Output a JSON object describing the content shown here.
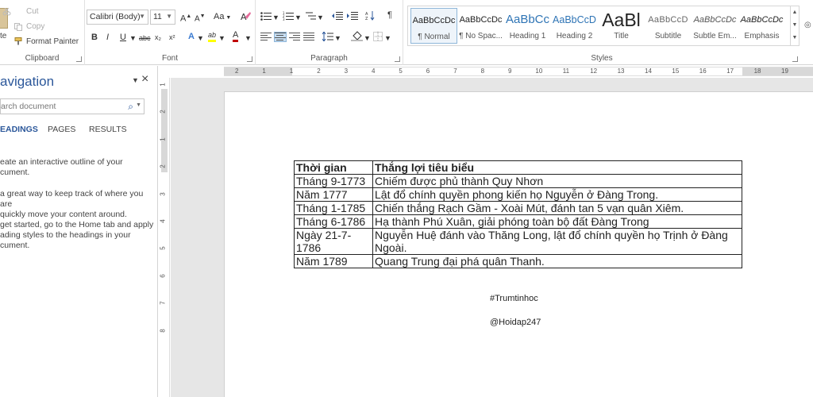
{
  "clipboard": {
    "cut_label": "Cut",
    "copy_label": "Copy",
    "format_painter_label": "Format Painter",
    "paste_fragment": "te",
    "group_label": "Clipboard"
  },
  "font": {
    "family": "Calibri (Body)",
    "size": "11",
    "grow": "A",
    "shrink": "A",
    "change_case": "Aa",
    "bold": "B",
    "italic": "I",
    "underline": "U",
    "strikethrough": "abc",
    "subscript": "x₂",
    "superscript": "x²",
    "text_effects": "A",
    "highlight": "ab",
    "font_color": "A",
    "group_label": "Font"
  },
  "paragraph": {
    "show_marks": "¶",
    "group_label": "Paragraph"
  },
  "styles": {
    "group_label": "Styles",
    "items": [
      {
        "sample": "AaBbCcDc",
        "name": "¶ Normal"
      },
      {
        "sample": "AaBbCcDc",
        "name": "¶ No Spac..."
      },
      {
        "sample": "AaBbCc",
        "name": "Heading 1"
      },
      {
        "sample": "AaBbCcD",
        "name": "Heading 2"
      },
      {
        "sample": "AaBl",
        "name": "Title"
      },
      {
        "sample": "AaBbCcD",
        "name": "Subtitle"
      },
      {
        "sample": "AaBbCcDc",
        "name": "Subtle Em..."
      },
      {
        "sample": "AaBbCcDc",
        "name": "Emphasis"
      }
    ]
  },
  "nav": {
    "title": "avigation",
    "search_placeholder": "arch document",
    "tabs": [
      "EADINGS",
      "PAGES",
      "RESULTS"
    ],
    "paragraphs": [
      "eate an interactive outline of your\ncument.",
      "a great way to keep track of where you are\nquickly move your content around.",
      "get started, go to the Home tab and apply\nading styles to the headings in your\ncument."
    ]
  },
  "ruler": {
    "h_ticks": [
      "2",
      "1",
      "1",
      "2",
      "3",
      "4",
      "5",
      "6",
      "7",
      "8",
      "9",
      "10",
      "11",
      "12",
      "13",
      "14",
      "15",
      "16",
      "17",
      "18",
      "19"
    ],
    "v_ticks": [
      "1",
      "2",
      "1",
      "2",
      "3",
      "4",
      "5",
      "6",
      "7",
      "8"
    ]
  },
  "document": {
    "table": {
      "headers": [
        "Thời gian",
        "Thắng lợi tiêu biểu"
      ],
      "rows": [
        [
          "Tháng 9-1773",
          "Chiếm được phủ thành Quy Nhơn"
        ],
        [
          "Năm 1777",
          "Lật đổ chính quyền phong kiến họ Nguyễn ở Đàng Trong."
        ],
        [
          "Tháng 1-1785",
          "Chiến thắng Rạch Gầm - Xoài Mút, đánh tan 5 vạn quân Xiêm."
        ],
        [
          "Tháng 6-1786",
          "Hạ thành Phú Xuân, giải phóng toàn bộ đất Đàng Trong"
        ],
        [
          "Ngày 21-7-1786",
          "Nguyễn Huệ đánh vào Thăng Long, lật đổ chính quyền họ Trịnh ở Đàng Ngoài."
        ],
        [
          "Năm 1789",
          "Quang Trung đại phá quân Thanh."
        ]
      ]
    },
    "tag1": "#Trumtinhoc",
    "tag2": "@Hoidap247"
  },
  "colors": {
    "accent": "#2b579a",
    "highlight": "#ffff00",
    "font_color": "#c00000"
  }
}
